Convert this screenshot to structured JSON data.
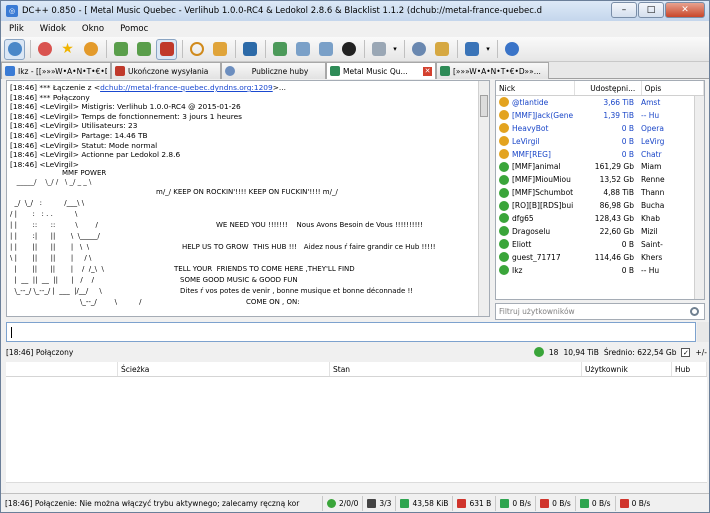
{
  "window": {
    "title": "DC++ 0.850 - [ Metal Music Quebec - Verlihub 1.0.0-RC4 & Ledokol 2.8.6 & Blacklist 1.1.2 (dchub://metal-france-quebec.dyndns.org:1209) ]",
    "minimize": "–",
    "maximize": "□",
    "close": "✕"
  },
  "menu": [
    "Plik",
    "Widok",
    "Okno",
    "Pomoc"
  ],
  "tabs": [
    {
      "label": "Ikz - [[»»»W•A•N•T•€•D...",
      "color": "#3a7bd5"
    },
    {
      "label": "Ukończone wysyłania",
      "color": "#c0392b"
    },
    {
      "label": "Publiczne huby",
      "color": "#6c8ebf"
    },
    {
      "label": "Metal Music Qu...",
      "color": "#2e8b57",
      "close": "✕"
    },
    {
      "label": "[»»»W•A•N•T•€•D»»...",
      "color": "#2e8b57"
    }
  ],
  "chat": {
    "lines": [
      {
        "pre": "[18:46] *** Łączenie z <",
        "link": "dchub://metal-france-quebec.dyndns.org:1209",
        "post": ">..."
      },
      {
        "pre": "[18:46] *** Połączony",
        "link": "",
        "post": ""
      },
      {
        "pre": "[18:46] <LeVirgil> Mistigris: Verlihub 1.0.0-RC4 @ 2015-01-26",
        "link": "",
        "post": ""
      },
      {
        "pre": "[18:46] <LeVirgil> Temps de fonctionnement: 3 jours 1 heures",
        "link": "",
        "post": ""
      },
      {
        "pre": "[18:46] <LeVirgil> Utilisateurs: 23",
        "link": "",
        "post": ""
      },
      {
        "pre": "[18:46] <LeVirgil> Partage: 14.46 TB",
        "link": "",
        "post": ""
      },
      {
        "pre": "[18:46] <LeVirgil> Statut: Mode normal",
        "link": "",
        "post": ""
      },
      {
        "pre": "[18:46] <LeVirgil> Actionne par Ledokol 2.8.6",
        "link": "",
        "post": ""
      },
      {
        "pre": "[18:46] <LeVirgil>",
        "link": "",
        "post": ""
      }
    ],
    "ascii": {
      "t1": "MMF POWER",
      "t2": "m/_/ KEEP ON ROCKIN'!!!! KEEP ON FUCKIN'!!!! m/_/",
      "t3": "WE NEED YOU !!!!!!!    Nous Avons Besoin de Vous !!!!!!!!!!",
      "t4": "HELP US TO GROW  THIS HUB !!!   Aidez nous ŕ faire grandir ce Hub !!!!!",
      "t5": "TELL YOUR  FRIENDS TO COME HERE ,THEY'LL FIND",
      "t6": "SOME GOOD MUSIC & GOOD FUN",
      "t7": "Dites ŕ vos potes de venir , bonne musique et bonne déconnade !!",
      "t8": "COME ON , ON:"
    }
  },
  "userlist": {
    "headers": {
      "nick": "Nick",
      "share": "Udostępni...",
      "desc": "Opis"
    },
    "users": [
      {
        "nick": "@tlantide",
        "share": "3,66 TiB",
        "desc": "Amst",
        "type": "op",
        "blue": true
      },
      {
        "nick": "[MMF]Jack(General)",
        "share": "1,39 TiB",
        "desc": "-- Hu",
        "type": "op",
        "blue": true
      },
      {
        "nick": "HeavyBot",
        "share": "0 B",
        "desc": "Opera",
        "type": "op",
        "blue": true
      },
      {
        "nick": "LeVirgil",
        "share": "0 B",
        "desc": "LeVirg",
        "type": "op",
        "blue": true
      },
      {
        "nick": "MMF[REG]",
        "share": "0 B",
        "desc": "Chatr",
        "type": "op",
        "blue": true
      },
      {
        "nick": "[MMF]animal",
        "share": "161,29 Gb",
        "desc": "Miam",
        "type": "nm",
        "blue": false
      },
      {
        "nick": "[MMF]MiouMiou",
        "share": "13,52 Gb",
        "desc": "Renne",
        "type": "nm",
        "blue": false
      },
      {
        "nick": "[MMF]Schumbot@Sha...",
        "share": "4,88 TiB",
        "desc": "Thann",
        "type": "nm",
        "blue": false
      },
      {
        "nick": "[RO][B][RDS]buiber",
        "share": "86,98 Gb",
        "desc": "Bucha",
        "type": "nm",
        "blue": false
      },
      {
        "nick": "dfg65",
        "share": "128,43 Gb",
        "desc": "Khab",
        "type": "nm",
        "blue": false
      },
      {
        "nick": "Dragoselu",
        "share": "22,60 Gb",
        "desc": "Mizil",
        "type": "nm",
        "blue": false
      },
      {
        "nick": "Eliott",
        "share": "0 B",
        "desc": "Saint-",
        "type": "nm",
        "blue": false
      },
      {
        "nick": "guest_71717",
        "share": "114,46 Gb",
        "desc": "Khers",
        "type": "nm",
        "blue": false
      },
      {
        "nick": "Ikz",
        "share": "0 B",
        "desc": "-- Hu",
        "type": "nm",
        "blue": false
      }
    ],
    "filter_placeholder": "Filtruj użytkowników"
  },
  "hub_status": {
    "text": "[18:46] Połączony",
    "users": "18",
    "share": "10,94 TiB",
    "avg": "Średnio: 622,54 Gb",
    "pm": "+/-"
  },
  "transfers": {
    "headers": {
      "c0": "",
      "path": "Ścieżka",
      "state": "Stan",
      "user": "Użytkownik",
      "hub": "Hub"
    }
  },
  "statusbar": {
    "message": "[18:46] Połączenie: Nie można włączyć trybu aktywnego; zalecamy ręczną kor",
    "hubs": "2/0/0",
    "slots": "3/3",
    "down_total": "43,58 KiB",
    "up_total": "631 B",
    "down_rate": "0 B/s",
    "up_rate": "0 B/s",
    "down_limit": "0 B/s",
    "up_limit": "0 B/s"
  }
}
